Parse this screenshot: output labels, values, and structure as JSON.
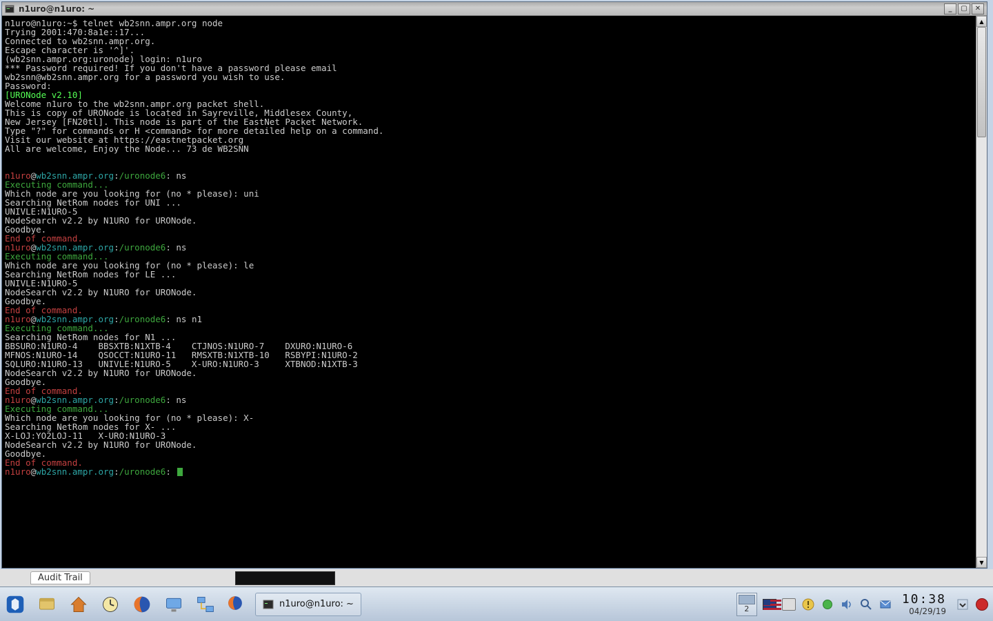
{
  "window": {
    "title": "n1uro@n1uro: ~"
  },
  "prompt_user": "n1uro",
  "prompt_host": "wb2snn.ampr.org",
  "prompt_path": "/uronode6",
  "prompt_sep": ":",
  "prompt_local_prefix": "n1uro@n1uro:~$ ",
  "cmd_initial": "telnet wb2snn.ampr.org node",
  "login_block": [
    "Trying 2001:470:8a1e::17...",
    "Connected to wb2snn.ampr.org.",
    "Escape character is '^]'.",
    "(wb2snn.ampr.org:uronode) login: n1uro",
    "*** Password required! If you don't have a password please email",
    "wb2snn@wb2snn.ampr.org for a password you wish to use.",
    "Password:"
  ],
  "banner_tag": "[URONode v2.10]",
  "banner_lines": [
    "Welcome n1uro to the wb2snn.ampr.org packet shell.",
    "This is copy of URONode is located in Sayreville, Middlesex County,",
    "New Jersey [FN20tl]. This node is part of the EastNet Packet Network.",
    "Type \"?\" for commands or H <command> for more detailed help on a command.",
    "Visit our website at https://eastnetpacket.org",
    "All are welcome, Enjoy the Node... 73 de WB2SNN"
  ],
  "exec_label": "Executing command...",
  "end_label": "End of command.",
  "sessions": [
    {
      "cmd": "ns",
      "body": [
        "Which node are you looking for (no * please): uni",
        "Searching NetRom nodes for UNI ...",
        "UNIVLE:N1URO-5",
        "NodeSearch v2.2 by N1URO for URONode.",
        "Goodbye."
      ]
    },
    {
      "cmd": "ns",
      "body": [
        "Which node are you looking for (no * please): le",
        "Searching NetRom nodes for LE ...",
        "UNIVLE:N1URO-5",
        "NodeSearch v2.2 by N1URO for URONode.",
        "Goodbye."
      ]
    },
    {
      "cmd": "ns n1",
      "body": [
        "Searching NetRom nodes for N1 ...",
        "BBSURO:N1URO-4    BBSXTB:N1XTB-4    CTJNOS:N1URO-7    DXURO:N1URO-6",
        "MFNOS:N1URO-14    QSOCCT:N1URO-11   RMSXTB:N1XTB-10   RSBYPI:N1URO-2",
        "SQLURO:N1URO-13   UNIVLE:N1URO-5    X-URO:N1URO-3     XTBNOD:N1XTB-3",
        "NodeSearch v2.2 by N1URO for URONode.",
        "Goodbye."
      ]
    },
    {
      "cmd": "ns",
      "body": [
        "Which node are you looking for (no * please): X-",
        "Searching NetRom nodes for X- ...",
        "X-LOJ:YO2LOJ-11   X-URO:N1URO-3",
        "NodeSearch v2.2 by N1URO for URONode.",
        "Goodbye."
      ]
    }
  ],
  "behind": {
    "tab_label": "Audit Trail"
  },
  "taskbar": {
    "task_label": "n1uro@n1uro: ~",
    "pager_num": "2",
    "clock": "10:38",
    "date": "04/29/19"
  }
}
